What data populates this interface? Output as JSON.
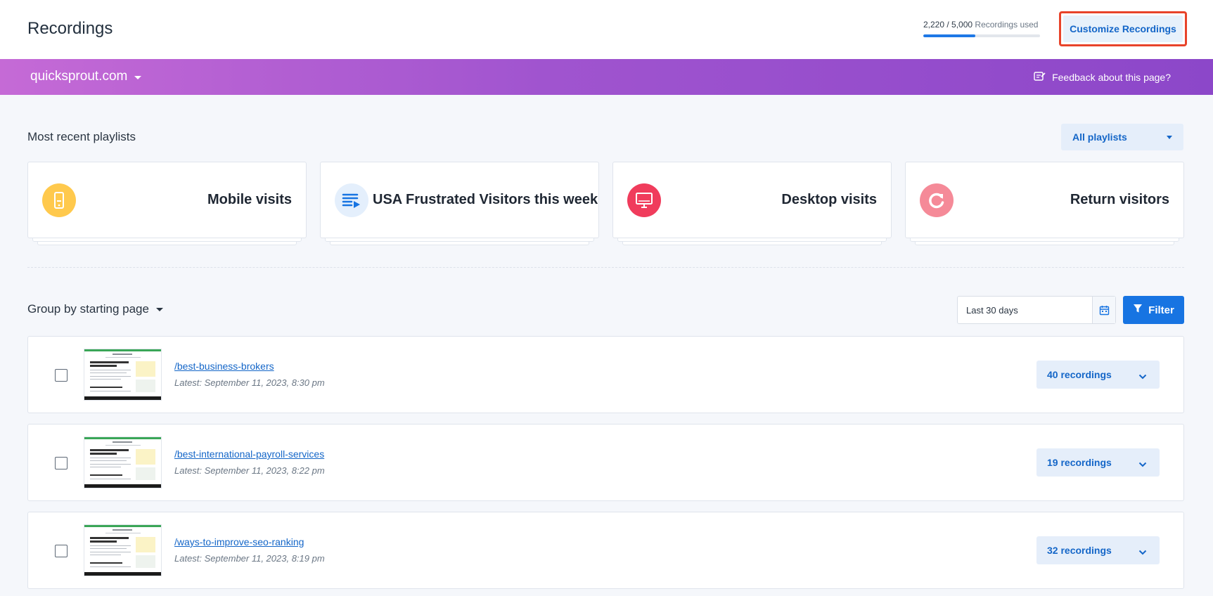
{
  "header": {
    "title": "Recordings",
    "usage": {
      "used": "2,220",
      "separator": " / ",
      "total": "5,000",
      "suffix": " Recordings used",
      "fraction": 0.444
    },
    "customize_label": "Customize Recordings"
  },
  "sitebar": {
    "site_name": "quicksprout.com",
    "feedback_label": "Feedback about this page?"
  },
  "playlists": {
    "title": "Most recent playlists",
    "select_label": "All playlists",
    "cards": [
      {
        "label": "Mobile visits",
        "icon": "mobile-icon",
        "color": "#ffc94d"
      },
      {
        "label": "USA Frustrated Visitors this week",
        "icon": "playlist-icon",
        "color": "#e4effc"
      },
      {
        "label": "Desktop visits",
        "icon": "desktop-icon",
        "color": "#f03c5c"
      },
      {
        "label": "Return visitors",
        "icon": "return-icon",
        "color": "#f58a98"
      }
    ]
  },
  "groupby": {
    "label": "Group by starting page",
    "date_range": "Last 30 days",
    "filter_label": "Filter"
  },
  "pages": [
    {
      "path": "/best-business-brokers",
      "latest": "Latest: September 11, 2023, 8:30 pm",
      "recordings": "40 recordings"
    },
    {
      "path": "/best-international-payroll-services",
      "latest": "Latest: September 11, 2023, 8:22 pm",
      "recordings": "19 recordings"
    },
    {
      "path": "/ways-to-improve-seo-ranking",
      "latest": "Latest: September 11, 2023, 8:19 pm",
      "recordings": "32 recordings"
    }
  ]
}
